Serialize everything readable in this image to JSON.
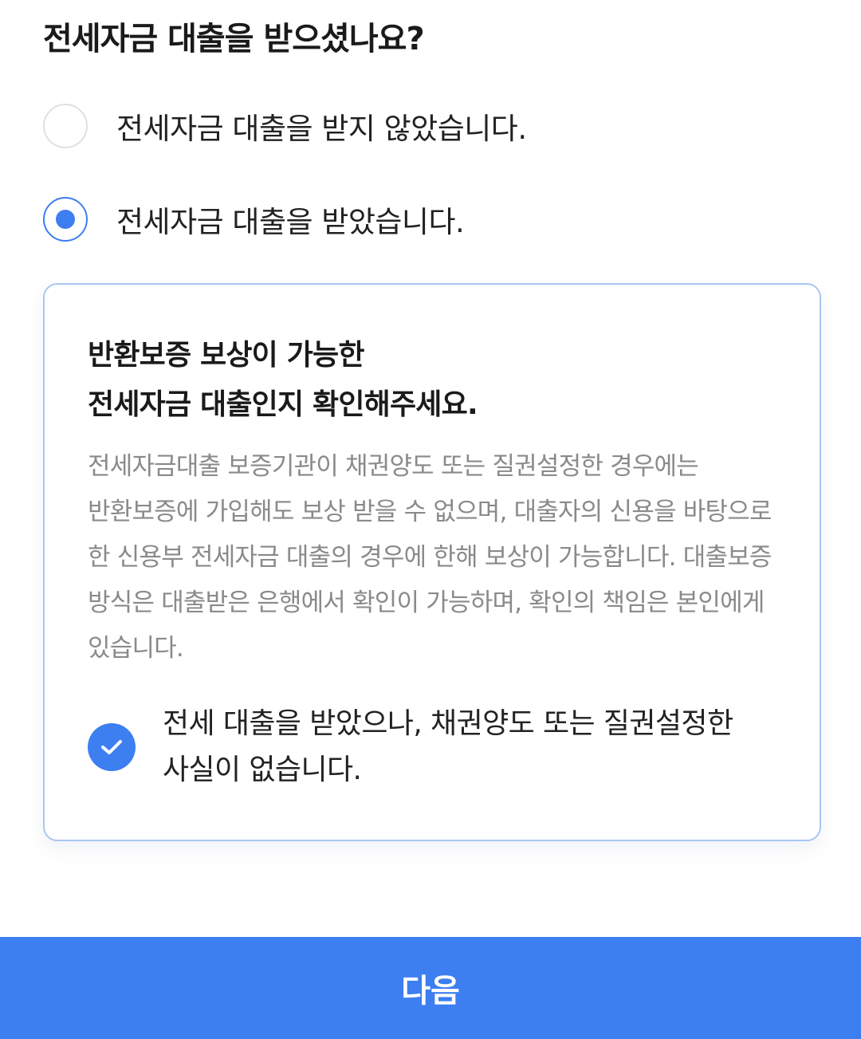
{
  "question": {
    "title": "전세자금 대출을 받으셨나요?"
  },
  "options": [
    {
      "label": "전세자금 대출을 받지 않았습니다.",
      "selected": false
    },
    {
      "label": "전세자금 대출을 받았습니다.",
      "selected": true
    }
  ],
  "info_card": {
    "title_line1": "반환보증 보상이 가능한",
    "title_line2": "전세자금 대출인지 확인해주세요.",
    "description": "전세자금대출 보증기관이 채권양도 또는 질권설정한 경우에는 반환보증에 가입해도 보상 받을 수 없으며, 대출자의 신용을 바탕으로 한 신용부 전세자금 대출의 경우에 한해 보상이 가능합니다. 대출보증 방식은 대출받은 은행에서 확인이 가능하며, 확인의 책임은 본인에게 있습니다.",
    "confirm_label": "전세 대출을 받았으나, 채권양도 또는 질권설정한 사실이 없습니다.",
    "confirm_checked": true,
    "check_icon": "check-icon"
  },
  "footer": {
    "next_label": "다음"
  },
  "colors": {
    "accent": "#3d7ef0",
    "card_border": "#a9c6f2",
    "muted_text": "#8a8a8a"
  }
}
